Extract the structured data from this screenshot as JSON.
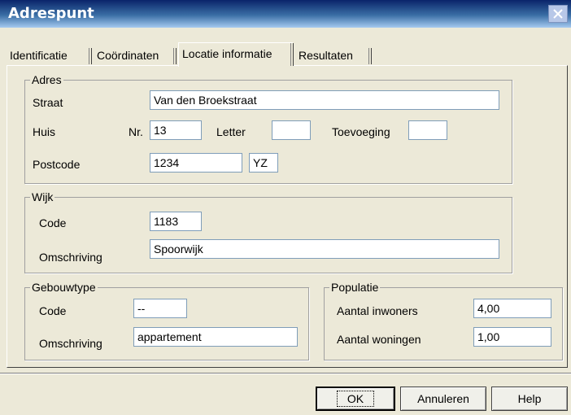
{
  "window": {
    "title": "Adrespunt"
  },
  "tabs": [
    {
      "label": "Identificatie",
      "active": false
    },
    {
      "label": "Coördinaten",
      "active": false
    },
    {
      "label": "Locatie informatie",
      "active": true
    },
    {
      "label": "Resultaten",
      "active": false
    }
  ],
  "adres": {
    "legend": "Adres",
    "straat_label": "Straat",
    "straat_value": "Van den Broekstraat",
    "huis_label": "Huis",
    "nr_label": "Nr.",
    "nr_value": "13",
    "letter_label": "Letter",
    "letter_value": "",
    "toevoeging_label": "Toevoeging",
    "toevoeging_value": "",
    "postcode_label": "Postcode",
    "postcode_digits": "1234",
    "postcode_letters": "YZ"
  },
  "wijk": {
    "legend": "Wijk",
    "code_label": "Code",
    "code_value": "1183",
    "omschrijving_label": "Omschriving",
    "omschrijving_value": "Spoorwijk"
  },
  "gebouwtype": {
    "legend": "Gebouwtype",
    "code_label": "Code",
    "code_value": "--",
    "omschrijving_label": "Omschriving",
    "omschrijving_value": "appartement"
  },
  "populatie": {
    "legend": "Populatie",
    "inwoners_label": "Aantal inwoners",
    "inwoners_value": "4,00",
    "woningen_label": "Aantal woningen",
    "woningen_value": "1,00"
  },
  "buttons": {
    "ok": "OK",
    "cancel": "Annuleren",
    "help": "Help"
  },
  "colors": {
    "title_gradient_start": "#0a246a",
    "title_gradient_end": "#a6caf0",
    "face": "#ece9d8"
  },
  "icons": {
    "close": "close-icon"
  }
}
